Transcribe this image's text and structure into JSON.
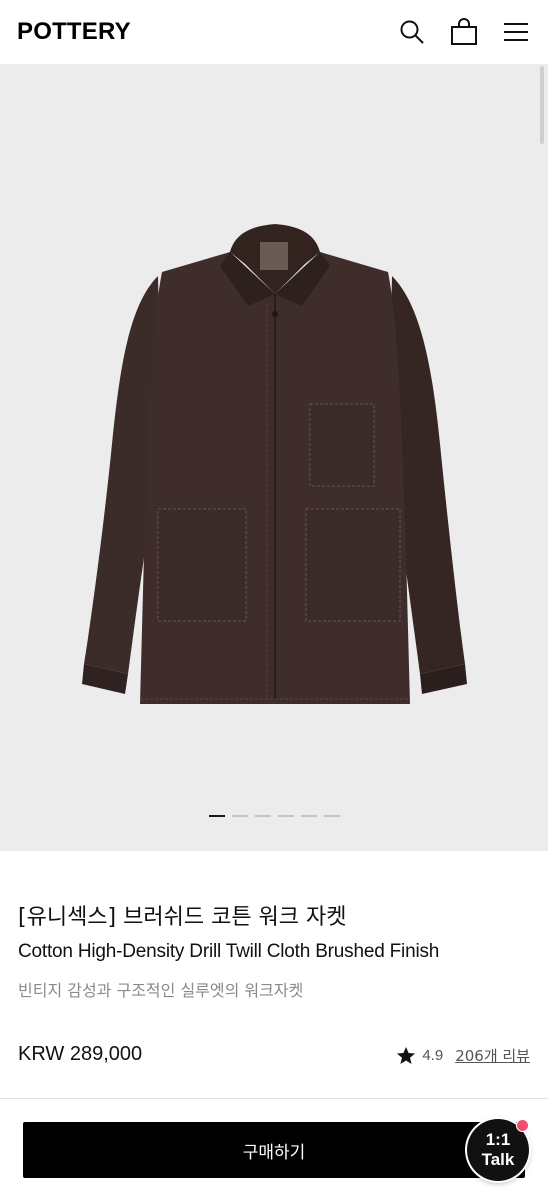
{
  "header": {
    "logo": "POTTERY",
    "icons": [
      "search-icon",
      "bag-icon",
      "menu-icon"
    ]
  },
  "gallery": {
    "slide_count": 6,
    "active_index": 0
  },
  "product": {
    "title_ko": "[유니섹스] 브러쉬드 코튼 워크 자켓",
    "title_en": "Cotton High-Density Drill Twill Cloth Brushed Finish",
    "subtitle": "빈티지 감성과 구조적인 실루엣의 워크자켓",
    "price": "KRW 289,000",
    "rating": "4.9",
    "reviews": "206개 리뷰"
  },
  "actions": {
    "buy_label": "구매하기",
    "talk_line1": "1:1",
    "talk_line2": "Talk"
  },
  "colors": {
    "jacket": "#3a2a28",
    "hero_bg": "#ececec",
    "badge": "#f0506e"
  }
}
